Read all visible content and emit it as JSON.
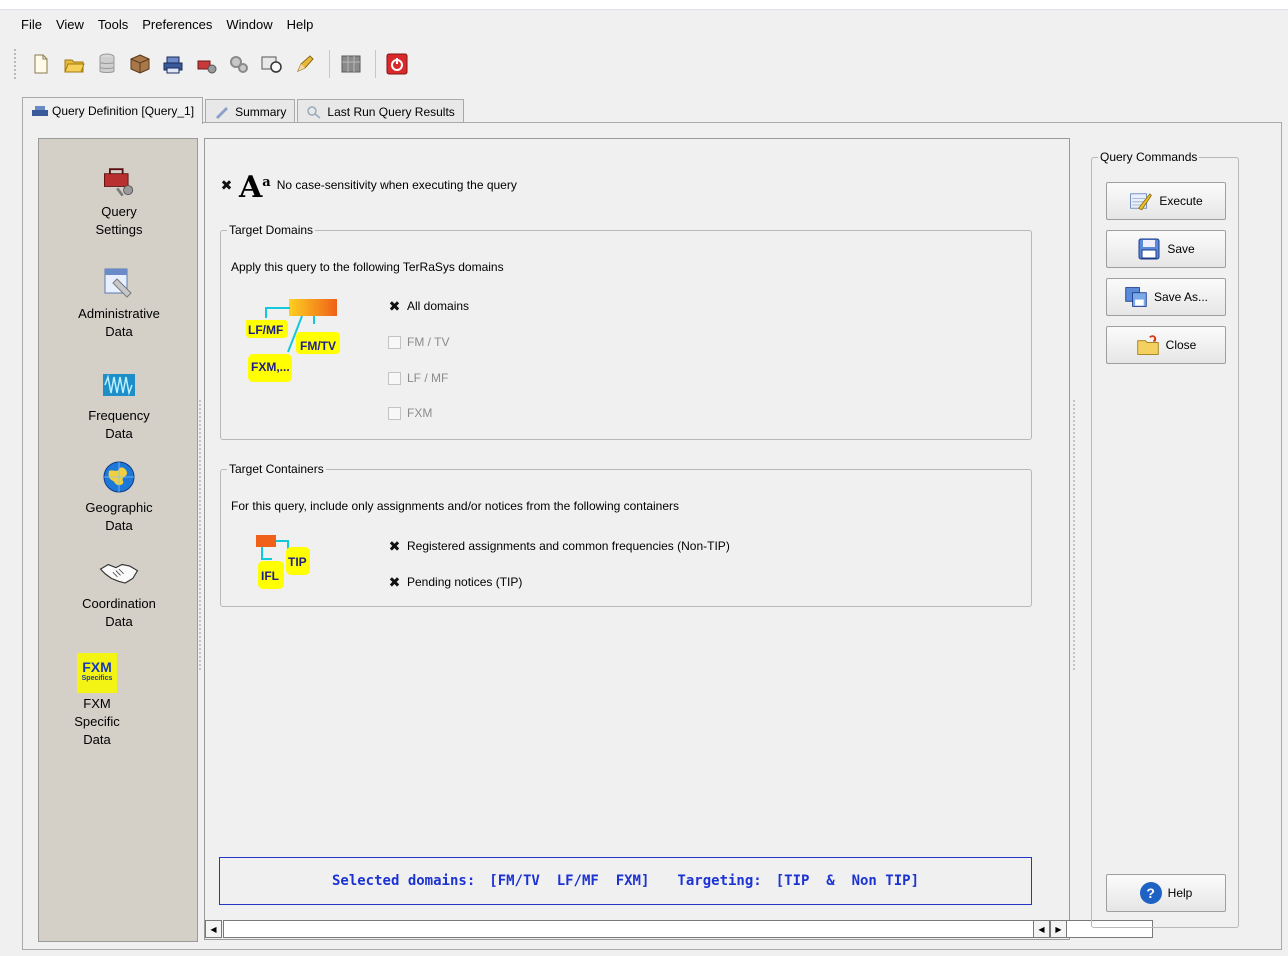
{
  "menu": [
    "File",
    "View",
    "Tools",
    "Preferences",
    "Window",
    "Help"
  ],
  "toolbar": {
    "buttons": [
      "new-file-icon",
      "open-folder-icon",
      "database-icon",
      "package-icon",
      "printer-icon",
      "tool-icon",
      "gears-icon",
      "filter-icon",
      "pencil-icon",
      "grid-icon",
      "power-icon"
    ]
  },
  "tabs": [
    {
      "label": "Query Definition [Query_1]",
      "icon": "query-icon",
      "active": true
    },
    {
      "label": "Summary",
      "icon": "summary-icon",
      "active": false
    },
    {
      "label": "Last Run Query Results",
      "icon": "results-icon",
      "active": false
    }
  ],
  "nav": [
    {
      "label": "Query\nSettings",
      "icon": "toolbox-icon"
    },
    {
      "label": "Administrative\nData",
      "icon": "calendar-icon"
    },
    {
      "label": "Frequency\nData",
      "icon": "waveform-icon"
    },
    {
      "label": "Geographic\nData",
      "icon": "globe-icon"
    },
    {
      "label": "Coordination\nData",
      "icon": "handshake-icon"
    },
    {
      "label": "FXM\nSpecific\nData",
      "icon": "fxm-icon",
      "icon_text": "FXM",
      "icon_subtext": "Specifics"
    }
  ],
  "case_sensitivity": {
    "checked": true,
    "label": "No case-sensitivity when executing the query"
  },
  "target_domains": {
    "legend": "Target Domains",
    "description": "Apply this query to the following TerRaSys domains",
    "diagram_labels": [
      "LF/MF",
      "FM/TV",
      "FXM,..."
    ],
    "options": [
      {
        "label": "All domains",
        "checked": true,
        "enabled": true
      },
      {
        "label": "FM / TV",
        "checked": false,
        "enabled": false
      },
      {
        "label": "LF / MF",
        "checked": false,
        "enabled": false
      },
      {
        "label": "FXM",
        "checked": false,
        "enabled": false
      }
    ]
  },
  "target_containers": {
    "legend": "Target Containers",
    "description": "For this query, include only assignments and/or notices from the following containers",
    "diagram_labels": [
      "TIP",
      "IFL"
    ],
    "options": [
      {
        "label": "Registered assignments and common frequencies (Non-TIP)",
        "checked": true
      },
      {
        "label": "Pending notices (TIP)",
        "checked": true
      }
    ]
  },
  "status": {
    "domains_label": "Selected domains:",
    "domains_value": "[FM/TV  LF/MF  FXM]",
    "targeting_label": "Targeting:",
    "targeting_value": "[TIP  &  Non TIP]"
  },
  "commands": {
    "legend": "Query Commands",
    "execute": "Execute",
    "save": "Save",
    "save_as": "Save As...",
    "close": "Close",
    "help": "Help"
  },
  "colors": {
    "status_text": "#1c33d2",
    "status_border": "#2336c8",
    "nav_bg": "#d4d0c8",
    "diagram_yellow": "#ffff00",
    "diagram_orange": "#f5821e",
    "diagram_cyan": "#14c8dc"
  }
}
